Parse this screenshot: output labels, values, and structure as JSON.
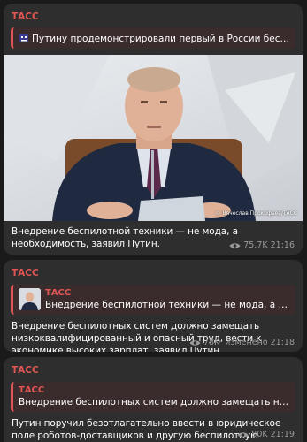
{
  "messages": [
    {
      "sender": "ТАСС",
      "reply": {
        "text": "Путину продемонстрировали первый в России беспило..."
      },
      "photo_credit": "© Вячеслав Прокофьев/ТАСС",
      "text": "Внедрение беспилотной техники — не мода, а необходимость, заявил Путин.",
      "views": "75.7K",
      "time": "21:16"
    },
    {
      "sender": "ТАСС",
      "reply": {
        "name": "ТАСС",
        "text": "Внедрение беспилотной техники — не мода, а необх..."
      },
      "text": "Внедрение беспилотных систем должно замещать низкоквалифицированный и опасный труд, вести к экономике высоких зарплат, заявил Путин.",
      "views": "78K",
      "edited": "изменено",
      "time": "21:18"
    },
    {
      "sender": "ТАСС",
      "reply": {
        "name": "ТАСС",
        "text": "Внедрение беспилотных систем должно замещать низкок..."
      },
      "text": "Путин поручил безотлагательно ввести в юридическое поле роботов-доставщиков и другую беспилотную технику.",
      "views": "80K",
      "time": "21:19"
    }
  ],
  "colors": {
    "accent": "#e05654",
    "bubble": "#2e2e2e",
    "background": "#1a1a1a",
    "meta": "#9a9a9a"
  },
  "icons": {
    "views": "eye-icon",
    "reply_sticker": "robot-icon"
  }
}
